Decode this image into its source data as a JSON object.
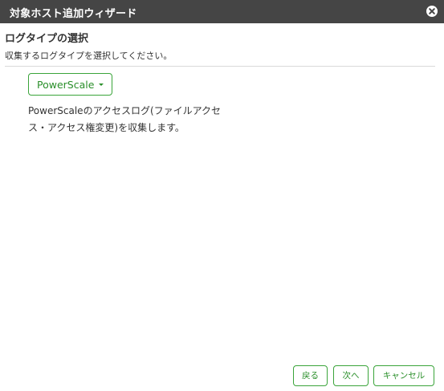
{
  "dialog": {
    "title": "対象ホスト追加ウィザード",
    "close_icon": "close-circle-icon"
  },
  "section": {
    "title": "ログタイプの選択",
    "description": "収集するログタイプを選択してください。"
  },
  "log_type": {
    "selected": "PowerScale",
    "dropdown_icon": "caret-down-icon",
    "description": "PowerScaleのアクセスログ(ファイルアクセス・アクセス権変更)を収集します。"
  },
  "footer": {
    "back_label": "戻る",
    "next_label": "次へ",
    "cancel_label": "キャンセル"
  },
  "colors": {
    "titlebar": "#454545",
    "accent": "#2a8f2a",
    "border": "#3aa43a",
    "divider": "#d9d9d9"
  }
}
